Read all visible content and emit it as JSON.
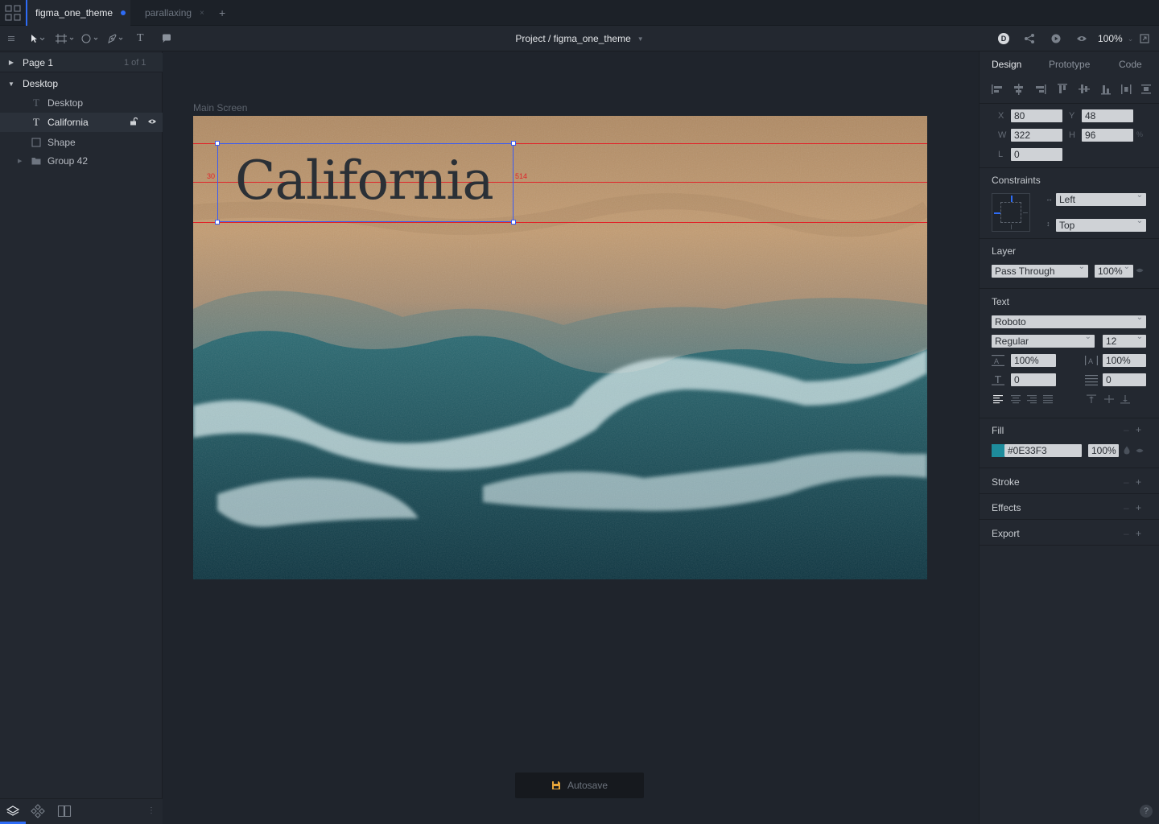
{
  "tabs": [
    {
      "label": "figma_one_theme",
      "active": true,
      "unsaved": true
    },
    {
      "label": "parallaxing",
      "active": false
    }
  ],
  "tab_add_label": "+",
  "toolbar": {
    "project_title": "Project / figma_one_theme",
    "avatar_initial": "D",
    "zoom": "100%"
  },
  "pages": {
    "current": "Page 1",
    "count": "1 of 1"
  },
  "layers": {
    "frame": "Desktop",
    "items": [
      {
        "label": "Desktop",
        "type": "text"
      },
      {
        "label": "California",
        "type": "text",
        "selected": true
      },
      {
        "label": "Shape",
        "type": "shape"
      },
      {
        "label": "Group 42",
        "type": "group"
      }
    ]
  },
  "canvas": {
    "frame_label": "Main Screen",
    "text": "California",
    "measure_left": "30",
    "measure_right": "514",
    "autosave": "Autosave"
  },
  "design_panel": {
    "tabs": [
      "Design",
      "Prototype",
      "Code"
    ],
    "x_label": "X",
    "x": "80",
    "y_label": "Y",
    "y": "48",
    "w_label": "W",
    "w": "322",
    "h_label": "H",
    "h": "96",
    "r_label": "L",
    "r": "0",
    "constraints_title": "Constraints",
    "constraint_h": "Left",
    "constraint_v": "Top",
    "layer_title": "Layer",
    "blend_mode": "Pass Through",
    "opacity": "100%",
    "text_title": "Text",
    "font_family": "Roboto",
    "font_weight": "Regular",
    "font_size": "12",
    "line_height": "100%",
    "letter_spacing": "100%",
    "paragraph_spacing": "0",
    "paragraph_indent": "0",
    "fill_title": "Fill",
    "fill_hex": "#0E33F3",
    "fill_opacity": "100%",
    "fill_swatch": "#1e8c9c",
    "stroke_title": "Stroke",
    "effects_title": "Effects",
    "export_title": "Export"
  },
  "colors": {
    "accent": "#2e6cf6",
    "guide": "#e0242a"
  }
}
